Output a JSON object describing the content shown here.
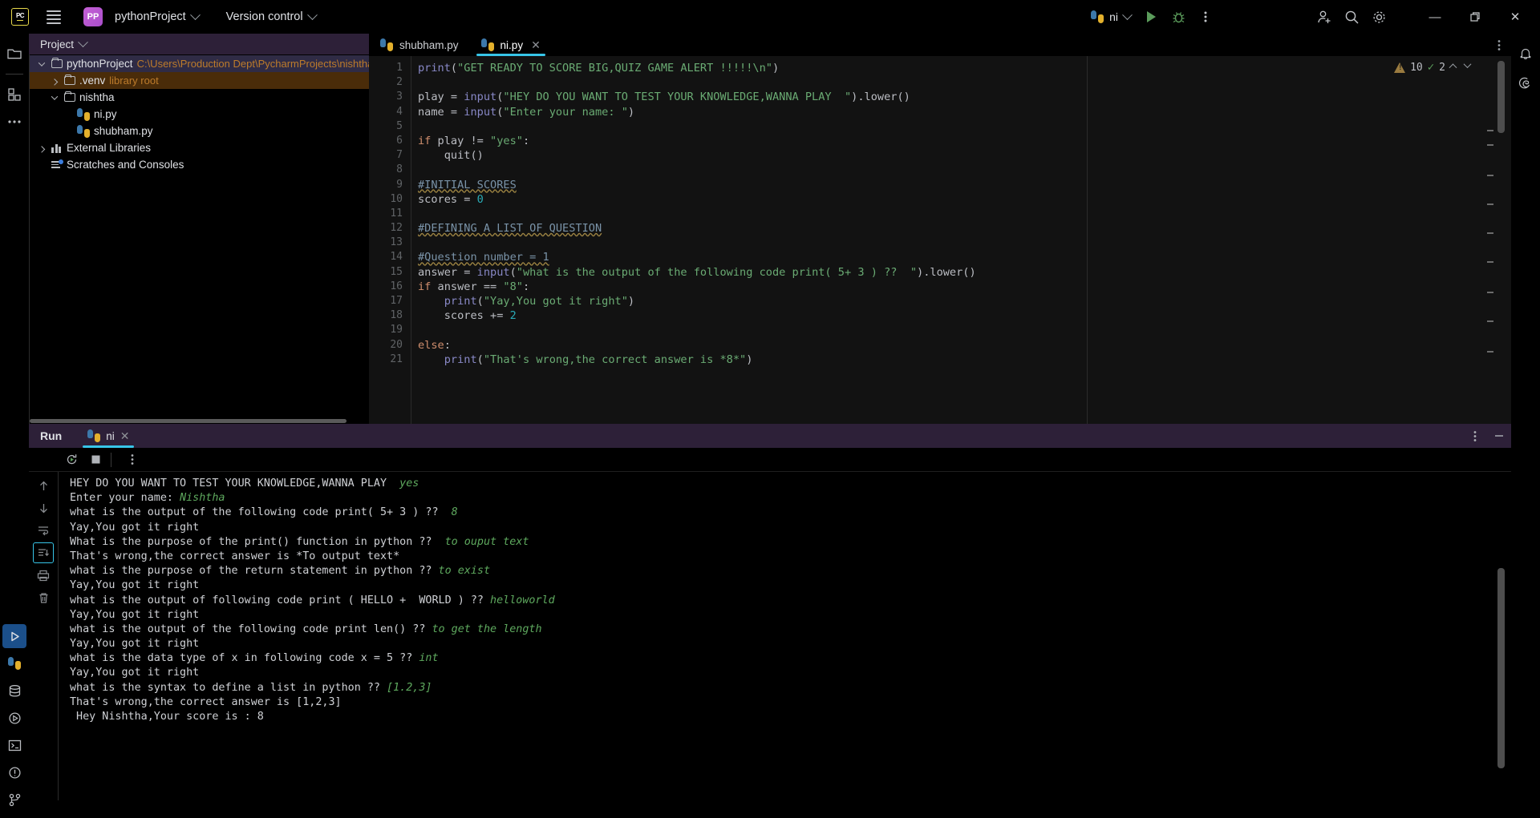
{
  "titlebar": {
    "logo": "pycharm-logo",
    "project_badge": "PP",
    "project_name": "pythonProject",
    "version_control": "Version control",
    "run_config": "ni",
    "icons": [
      "python-icon",
      "run-icon",
      "debug-icon",
      "more-options-icon",
      "add-user-icon",
      "search-icon",
      "settings-gear-icon"
    ],
    "window": {
      "minimize": "—",
      "maximize": "❐",
      "close": "✕"
    }
  },
  "left_rail": {
    "items": [
      {
        "name": "project-tool-window",
        "icon": "folder-icon"
      },
      {
        "name": "structure-tool-window",
        "icon": "blocks-icon"
      },
      {
        "name": "more-tool-windows",
        "icon": "ellipsis-icon"
      }
    ],
    "bottom": [
      {
        "name": "run-tool-window",
        "icon": "run-triangle-icon"
      },
      {
        "name": "python-packages",
        "icon": "python-icon"
      },
      {
        "name": "database",
        "icon": "database-icon"
      },
      {
        "name": "services",
        "icon": "play-circle-icon"
      },
      {
        "name": "terminal",
        "icon": "terminal-icon"
      },
      {
        "name": "problems",
        "icon": "warning-circle-icon"
      },
      {
        "name": "version-control",
        "icon": "branch-icon"
      }
    ]
  },
  "project_panel": {
    "title": "Project",
    "tree": [
      {
        "label": "pythonProject",
        "path": "C:\\Users\\Production Dept\\PycharmProjects\\nishtha\\pythonP",
        "depth": 0,
        "arrow": "open",
        "icon": "folder-icon",
        "state": "selected-blue"
      },
      {
        "label": ".venv",
        "extra": "library root",
        "depth": 1,
        "arrow": "closed",
        "icon": "folder-icon",
        "state": "selected-brown"
      },
      {
        "label": "nishtha",
        "depth": 1,
        "arrow": "open",
        "icon": "folder-icon",
        "state": "none"
      },
      {
        "label": "ni.py",
        "depth": 2,
        "arrow": "none",
        "icon": "python-file-icon",
        "state": "none"
      },
      {
        "label": "shubham.py",
        "depth": 2,
        "arrow": "none",
        "icon": "python-file-icon",
        "state": "none"
      },
      {
        "label": "External Libraries",
        "depth": 0,
        "arrow": "closed",
        "icon": "libraries-icon",
        "state": "none"
      },
      {
        "label": "Scratches and Consoles",
        "depth": 0,
        "arrow": "none",
        "icon": "scratches-icon",
        "state": "none"
      }
    ]
  },
  "editor": {
    "tabs": [
      {
        "label": "shubham.py",
        "icon": "python-file-icon",
        "active": false,
        "closable": false
      },
      {
        "label": "ni.py",
        "icon": "python-file-icon",
        "active": true,
        "closable": true
      }
    ],
    "inspections": {
      "warnings": "10",
      "checks": "2",
      "warning_icon": "warning-triangle-icon",
      "ok_icon": "checkmark-icon"
    },
    "lines": [
      {
        "n": "1",
        "tokens": [
          {
            "t": "print",
            "c": "fn"
          },
          {
            "t": "(",
            "c": ""
          },
          {
            "t": "\"GET READY TO SCORE BIG,QUIZ GAME ALERT !!!!!\\n\"",
            "c": "s"
          },
          {
            "t": ")",
            "c": ""
          }
        ]
      },
      {
        "n": "2",
        "tokens": []
      },
      {
        "n": "3",
        "tokens": [
          {
            "t": "play = ",
            "c": ""
          },
          {
            "t": "input",
            "c": "fn"
          },
          {
            "t": "(",
            "c": ""
          },
          {
            "t": "\"HEY DO YOU WANT TO TEST YOUR KNOWLEDGE,WANNA PLAY  \"",
            "c": "s"
          },
          {
            "t": ").lower()",
            "c": ""
          }
        ]
      },
      {
        "n": "4",
        "tokens": [
          {
            "t": "name = ",
            "c": ""
          },
          {
            "t": "input",
            "c": "fn"
          },
          {
            "t": "(",
            "c": ""
          },
          {
            "t": "\"Enter your name: \"",
            "c": "s"
          },
          {
            "t": ")",
            "c": ""
          }
        ]
      },
      {
        "n": "5",
        "tokens": []
      },
      {
        "n": "6",
        "tokens": [
          {
            "t": "if",
            "c": "k"
          },
          {
            "t": " play != ",
            "c": ""
          },
          {
            "t": "\"yes\"",
            "c": "s"
          },
          {
            "t": ":",
            "c": ""
          }
        ]
      },
      {
        "n": "7",
        "tokens": [
          {
            "t": "    quit()",
            "c": ""
          }
        ]
      },
      {
        "n": "8",
        "tokens": []
      },
      {
        "n": "9",
        "tokens": [
          {
            "t": "#INITIAL SCORES",
            "c": "c spell"
          }
        ]
      },
      {
        "n": "10",
        "tokens": [
          {
            "t": "scores = ",
            "c": ""
          },
          {
            "t": "0",
            "c": "n"
          }
        ]
      },
      {
        "n": "11",
        "tokens": []
      },
      {
        "n": "12",
        "tokens": [
          {
            "t": "#DEFINING A LIST OF QUESTION",
            "c": "c spell"
          }
        ]
      },
      {
        "n": "13",
        "tokens": []
      },
      {
        "n": "14",
        "tokens": [
          {
            "t": "#Question number = 1",
            "c": "c spell"
          }
        ]
      },
      {
        "n": "15",
        "tokens": [
          {
            "t": "answer = ",
            "c": ""
          },
          {
            "t": "input",
            "c": "fn"
          },
          {
            "t": "(",
            "c": ""
          },
          {
            "t": "\"what is the output of the following code print( 5+ 3 ) ??  \"",
            "c": "s"
          },
          {
            "t": ").lower()",
            "c": ""
          }
        ]
      },
      {
        "n": "16",
        "tokens": [
          {
            "t": "if",
            "c": "k"
          },
          {
            "t": " answer == ",
            "c": ""
          },
          {
            "t": "\"8\"",
            "c": "s"
          },
          {
            "t": ":",
            "c": ""
          }
        ]
      },
      {
        "n": "17",
        "tokens": [
          {
            "t": "    ",
            "c": ""
          },
          {
            "t": "print",
            "c": "fn"
          },
          {
            "t": "(",
            "c": ""
          },
          {
            "t": "\"Yay,You got it right\"",
            "c": "s"
          },
          {
            "t": ")",
            "c": ""
          }
        ]
      },
      {
        "n": "18",
        "tokens": [
          {
            "t": "    scores += ",
            "c": ""
          },
          {
            "t": "2",
            "c": "n"
          }
        ]
      },
      {
        "n": "19",
        "tokens": []
      },
      {
        "n": "20",
        "tokens": [
          {
            "t": "else",
            "c": "k"
          },
          {
            "t": ":",
            "c": ""
          }
        ]
      },
      {
        "n": "21",
        "tokens": [
          {
            "t": "    ",
            "c": ""
          },
          {
            "t": "print",
            "c": "fn"
          },
          {
            "t": "(",
            "c": ""
          },
          {
            "t": "\"That's wrong,the correct answer is *8*\"",
            "c": "s"
          },
          {
            "t": ")",
            "c": ""
          }
        ]
      }
    ]
  },
  "run_panel": {
    "title": "Run",
    "tab": {
      "label": "ni",
      "icon": "python-file-icon"
    },
    "header_icons": [
      "more-vertical-icon",
      "minimize-icon"
    ],
    "toolbar": [
      "rerun-icon",
      "stop-icon",
      "more-vertical-icon"
    ],
    "gutter_icons": [
      "scroll-up-icon",
      "scroll-down-icon",
      "soft-wrap-icon",
      "scroll-to-end-icon",
      "print-icon",
      "clear-all-icon"
    ],
    "console": [
      {
        "text": "HEY DO YOU WANT TO TEST YOUR KNOWLEDGE,WANNA PLAY  ",
        "input": "yes"
      },
      {
        "text": "Enter your name: ",
        "input": "Nishtha"
      },
      {
        "text": "what is the output of the following code print( 5+ 3 ) ??  ",
        "input": "8"
      },
      {
        "text": "Yay,You got it right",
        "input": ""
      },
      {
        "text": "What is the purpose of the print() function in python ??  ",
        "input": "to ouput text"
      },
      {
        "text": "That's wrong,the correct answer is *To output text*",
        "input": ""
      },
      {
        "text": "what is the purpose of the return statement in python ?? ",
        "input": "to exist"
      },
      {
        "text": "Yay,You got it right",
        "input": ""
      },
      {
        "text": "what is the output of following code print ( HELLO +  WORLD ) ?? ",
        "input": "helloworld"
      },
      {
        "text": "Yay,You got it right",
        "input": ""
      },
      {
        "text": "what is the output of the following code print len() ?? ",
        "input": "to get the length"
      },
      {
        "text": "Yay,You got it right",
        "input": ""
      },
      {
        "text": "what is the data type of x in following code x = 5 ?? ",
        "input": "int"
      },
      {
        "text": "Yay,You got it right",
        "input": ""
      },
      {
        "text": "what is the syntax to define a list in python ?? ",
        "input": "[1.2,3]"
      },
      {
        "text": "That's wrong,the correct answer is [1,2,3]",
        "input": ""
      },
      {
        "text": " Hey Nishtha,Your score is : 8",
        "input": ""
      }
    ]
  },
  "right_rail": {
    "items": [
      {
        "name": "notifications",
        "icon": "bell-icon"
      },
      {
        "name": "ai-assistant",
        "icon": "spiral-icon"
      }
    ]
  },
  "statusbar": {
    "left": "",
    "right": ""
  },
  "colors": {
    "accent_cyan": "#37c5e8",
    "panel_header": "#2d2038",
    "string_green": "#6aab73",
    "keyword_orange": "#cf8e6d",
    "builtin_purple": "#8888c6",
    "comment_blue": "#7a93a8",
    "number_cyan": "#2aacb8",
    "path_orange": "#bd7b2b",
    "selected_brown": "#4a2c09",
    "input_green": "#5ea95e"
  }
}
